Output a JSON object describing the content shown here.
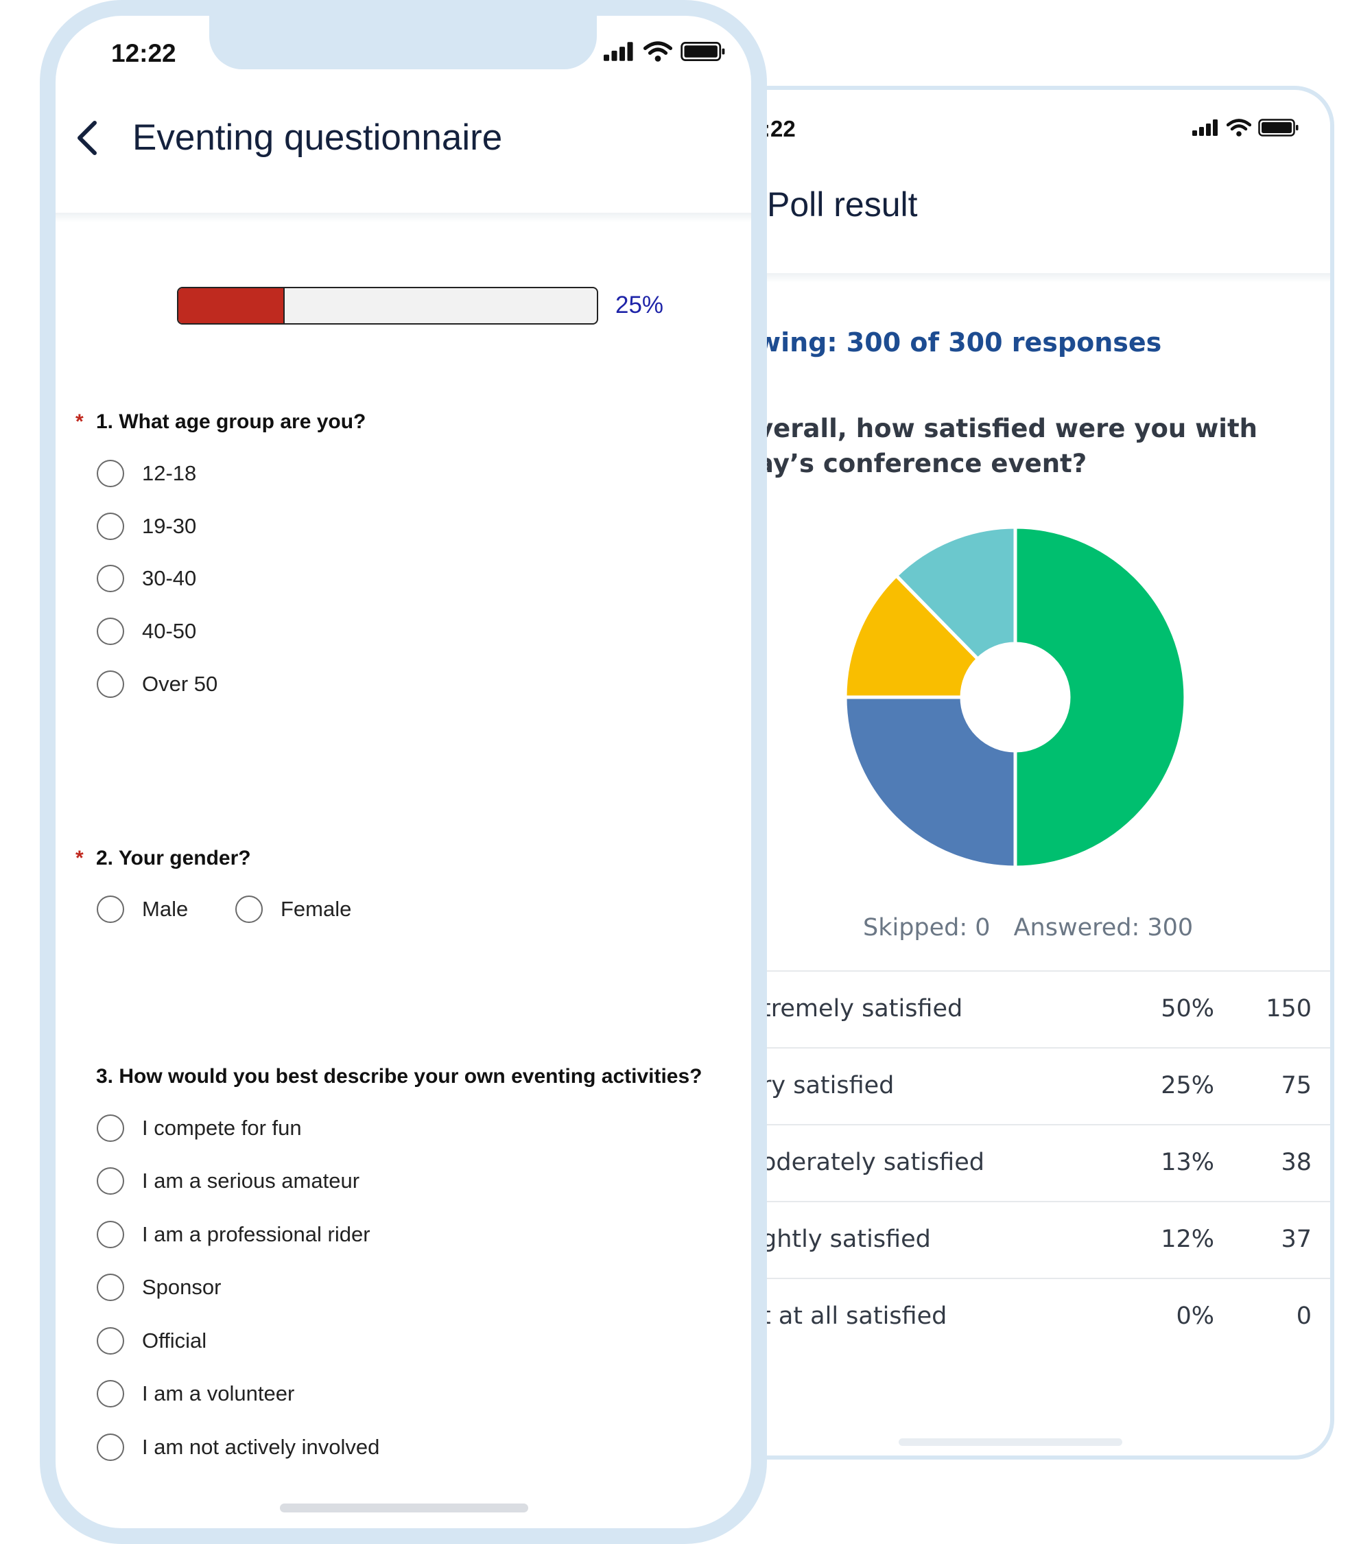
{
  "poll": {
    "time": ":22",
    "title": "Poll result",
    "viewing": "wing: 300 of 300 responses",
    "question_line1": "verall, how satisfied were you with",
    "question_line2": "ay’s conference event?",
    "skipped": "Skipped: 0",
    "answered": "Answered: 300",
    "rows": [
      {
        "label": "tremely satisfied",
        "pct": "50%",
        "count": "150"
      },
      {
        "label": "ry satisfied",
        "pct": "25%",
        "count": "75"
      },
      {
        "label": "oderately satisfied",
        "pct": "13%",
        "count": "38"
      },
      {
        "label": "ghtly satisfied",
        "pct": "12%",
        "count": "37"
      },
      {
        "label": "t at all satisfied",
        "pct": "0%",
        "count": "0"
      }
    ]
  },
  "chart_data": {
    "type": "pie",
    "variant": "donut",
    "series": [
      {
        "values": [
          150,
          75,
          38,
          37,
          0
        ],
        "colors": [
          "#00bf6f",
          "#507cb6",
          "#f9be00",
          "#6bc8cd",
          "#999999"
        ]
      }
    ]
  },
  "questionnaire": {
    "time": "12:22",
    "title": "Eventing questionnaire",
    "progress_percent": 25,
    "progress_label": "25%",
    "required_mark": "*",
    "q1": {
      "title": "1. What age group are you?",
      "options": [
        "12-18",
        "19-30",
        "30-40",
        "40-50",
        "Over 50"
      ]
    },
    "q2": {
      "title": "2. Your gender?",
      "options": [
        "Male",
        "Female"
      ]
    },
    "q3": {
      "title": "3. How would you best describe your own eventing activities?",
      "options": [
        "I compete for fun",
        "I am a serious amateur",
        "I am a professional rider",
        "Sponsor",
        "Official",
        "I am a volunteer",
        "I am not actively involved"
      ]
    }
  },
  "colors": {
    "frame": "#d6e6f3",
    "progress_fill": "#bf2a1f",
    "accent_blue": "#1d4c91",
    "required": "#c0281e"
  }
}
